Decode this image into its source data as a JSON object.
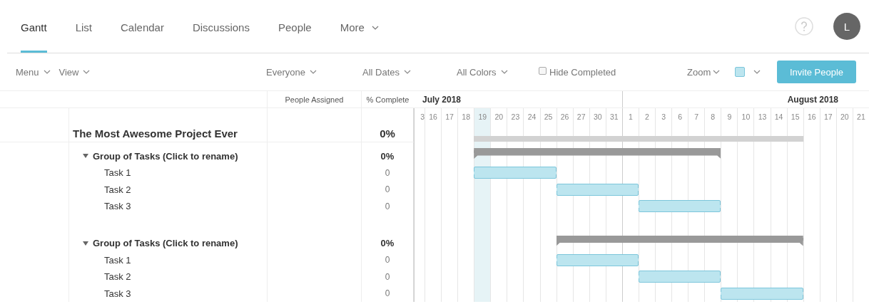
{
  "tabs": [
    {
      "label": "Gantt",
      "selected": true,
      "kind": "tab"
    },
    {
      "label": "List",
      "selected": false,
      "kind": "tab"
    },
    {
      "label": "Calendar",
      "selected": false,
      "kind": "tab"
    },
    {
      "label": "Discussions",
      "selected": false,
      "kind": "tab"
    },
    {
      "label": "People",
      "selected": false,
      "kind": "tab"
    },
    {
      "label": "More",
      "selected": false,
      "kind": "menu"
    }
  ],
  "avatar": {
    "initial": "L"
  },
  "toolbar": {
    "menus": [
      {
        "label": "Menu"
      },
      {
        "label": "View"
      }
    ],
    "filters": [
      {
        "label": "Everyone"
      },
      {
        "label": "All Dates"
      },
      {
        "label": "All Colors"
      }
    ],
    "hide_completed": {
      "label": "Hide Completed",
      "checked": false
    },
    "zoom": {
      "label": "Zoom"
    },
    "invite_button": {
      "label": "Invite People"
    }
  },
  "table": {
    "columns": [
      "People Assigned",
      "% Complete"
    ]
  },
  "timeline": {
    "months": [
      {
        "label": "July 2018"
      },
      {
        "label": "August 2018"
      }
    ],
    "days": [
      {
        "label": "3",
        "today": false,
        "month_start": true
      },
      {
        "label": "16",
        "today": false,
        "month_start": false
      },
      {
        "label": "17",
        "today": false,
        "month_start": false
      },
      {
        "label": "18",
        "today": false,
        "month_start": false
      },
      {
        "label": "19",
        "today": true,
        "month_start": false
      },
      {
        "label": "20",
        "today": false,
        "month_start": false
      },
      {
        "label": "23",
        "today": false,
        "month_start": false
      },
      {
        "label": "24",
        "today": false,
        "month_start": false
      },
      {
        "label": "25",
        "today": false,
        "month_start": false
      },
      {
        "label": "26",
        "today": false,
        "month_start": false
      },
      {
        "label": "27",
        "today": false,
        "month_start": false
      },
      {
        "label": "30",
        "today": false,
        "month_start": false
      },
      {
        "label": "31",
        "today": false,
        "month_start": false
      },
      {
        "label": "1",
        "today": false,
        "month_start": true
      },
      {
        "label": "2",
        "today": false,
        "month_start": false
      },
      {
        "label": "3",
        "today": false,
        "month_start": false
      },
      {
        "label": "6",
        "today": false,
        "month_start": false
      },
      {
        "label": "7",
        "today": false,
        "month_start": false
      },
      {
        "label": "8",
        "today": false,
        "month_start": false
      },
      {
        "label": "9",
        "today": false,
        "month_start": false
      },
      {
        "label": "10",
        "today": false,
        "month_start": false
      },
      {
        "label": "13",
        "today": false,
        "month_start": false
      },
      {
        "label": "14",
        "today": false,
        "month_start": false
      },
      {
        "label": "15",
        "today": false,
        "month_start": false
      },
      {
        "label": "16",
        "today": false,
        "month_start": false
      },
      {
        "label": "17",
        "today": false,
        "month_start": false
      },
      {
        "label": "20",
        "today": false,
        "month_start": false
      },
      {
        "label": "21",
        "today": false,
        "month_start": false
      }
    ]
  },
  "project": {
    "name": "The Most Awesome Project Ever",
    "complete": "0%",
    "bar_days": [
      false,
      false,
      false,
      false,
      true,
      true,
      true,
      true,
      true,
      true,
      true,
      true,
      true,
      true,
      true,
      true,
      true,
      true,
      true,
      true,
      true,
      true,
      true,
      true,
      false,
      false,
      false,
      false
    ],
    "children": [
      {
        "name": "Group of Tasks (Click to rename)",
        "expanded": true,
        "complete": "0%",
        "bar_days": [
          false,
          false,
          false,
          false,
          true,
          true,
          true,
          true,
          true,
          true,
          true,
          true,
          true,
          true,
          true,
          true,
          true,
          true,
          true,
          false,
          false,
          false,
          false,
          false,
          false,
          false,
          false,
          false
        ],
        "children": [
          {
            "name": "Task 1",
            "complete": "0",
            "bar_days": [
              false,
              false,
              false,
              false,
              true,
              true,
              true,
              true,
              true,
              false,
              false,
              false,
              false,
              false,
              false,
              false,
              false,
              false,
              false,
              false,
              false,
              false,
              false,
              false,
              false,
              false,
              false,
              false
            ]
          },
          {
            "name": "Task 2",
            "complete": "0",
            "bar_days": [
              false,
              false,
              false,
              false,
              false,
              false,
              false,
              false,
              false,
              true,
              true,
              true,
              true,
              true,
              false,
              false,
              false,
              false,
              false,
              false,
              false,
              false,
              false,
              false,
              false,
              false,
              false,
              false
            ]
          },
          {
            "name": "Task 3",
            "complete": "0",
            "bar_days": [
              false,
              false,
              false,
              false,
              false,
              false,
              false,
              false,
              false,
              false,
              false,
              false,
              false,
              false,
              true,
              true,
              true,
              true,
              true,
              false,
              false,
              false,
              false,
              false,
              false,
              false,
              false,
              false
            ]
          }
        ]
      },
      {
        "name": "Group of Tasks (Click to rename)",
        "expanded": true,
        "complete": "0%",
        "bar_days": [
          false,
          false,
          false,
          false,
          false,
          false,
          false,
          false,
          false,
          true,
          true,
          true,
          true,
          true,
          true,
          true,
          true,
          true,
          true,
          true,
          true,
          true,
          true,
          true,
          false,
          false,
          false,
          false
        ],
        "children": [
          {
            "name": "Task 1",
            "complete": "0",
            "bar_days": [
              false,
              false,
              false,
              false,
              false,
              false,
              false,
              false,
              false,
              true,
              true,
              true,
              true,
              true,
              false,
              false,
              false,
              false,
              false,
              false,
              false,
              false,
              false,
              false,
              false,
              false,
              false,
              false
            ]
          },
          {
            "name": "Task 2",
            "complete": "0",
            "bar_days": [
              false,
              false,
              false,
              false,
              false,
              false,
              false,
              false,
              false,
              false,
              false,
              false,
              false,
              false,
              true,
              true,
              true,
              true,
              true,
              false,
              false,
              false,
              false,
              false,
              false,
              false,
              false,
              false
            ]
          },
          {
            "name": "Task 3",
            "complete": "0",
            "bar_days": [
              false,
              false,
              false,
              false,
              false,
              false,
              false,
              false,
              false,
              false,
              false,
              false,
              false,
              false,
              false,
              false,
              false,
              false,
              false,
              true,
              true,
              true,
              true,
              true,
              false,
              false,
              false,
              false
            ]
          }
        ]
      }
    ]
  }
}
